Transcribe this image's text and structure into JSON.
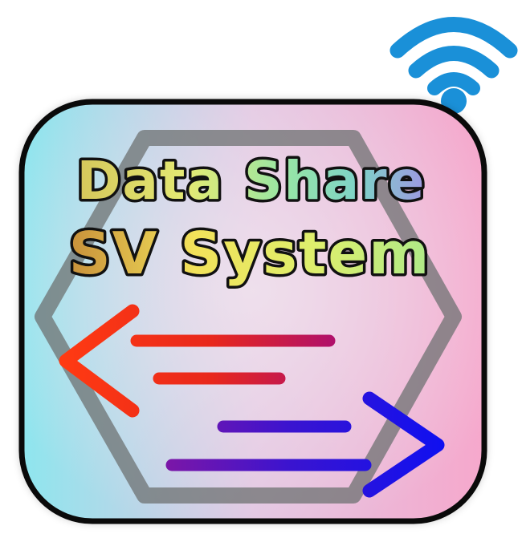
{
  "logo": {
    "title_line1": "Data Share",
    "title_line2": "SV System"
  },
  "colors": {
    "wifi": "#1a90d8",
    "frame_stroke": "#0a0a0a",
    "bg_left": "#8ee6ee",
    "bg_center": "#e2c6e2",
    "bg_right": "#f6a8cc",
    "hexagon": "#6e7272",
    "arrow_left_start": "#ff3a12",
    "arrow_left_end": "#b0106a",
    "arrow_right_start": "#7a16a8",
    "arrow_right_end": "#1010f0",
    "title_gradient": [
      "#c89038",
      "#f0e258",
      "#e2ee6e",
      "#a6ea88",
      "#7ed6c2",
      "#9a98e2"
    ]
  },
  "icons": {
    "wifi": "wifi-icon",
    "arrow_left": "arrow-left-icon",
    "arrow_right": "arrow-right-icon"
  }
}
